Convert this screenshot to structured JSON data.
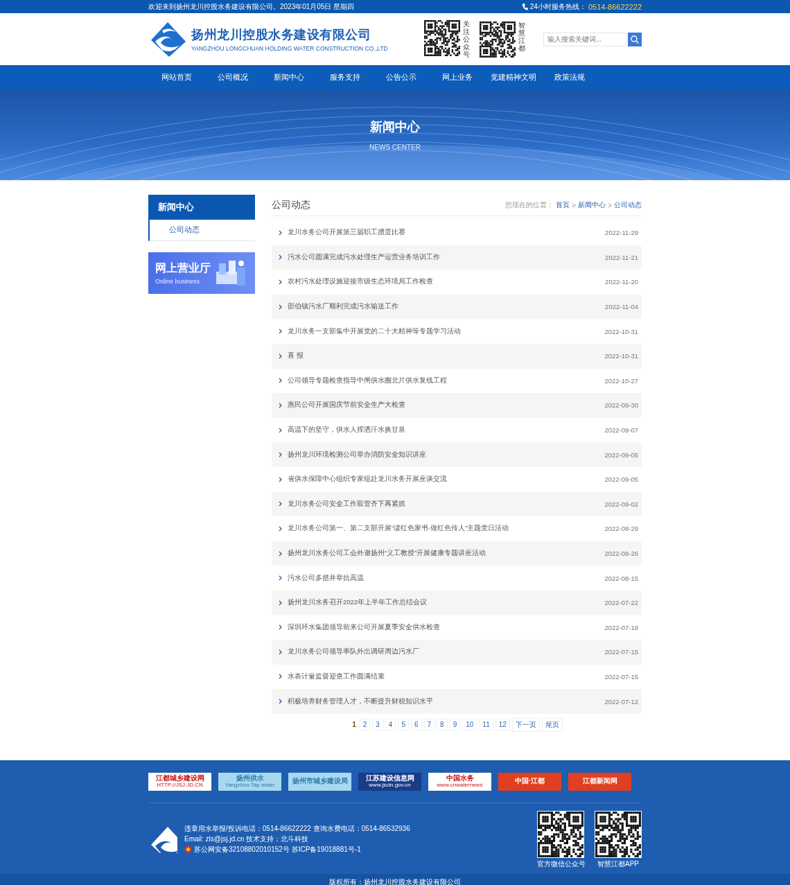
{
  "top_bar": {
    "welcome": "欢迎来到扬州龙川控股水务建设有限公司。2023年01月05日 星期四",
    "hotline_label": "24小时服务热线：",
    "hotline": "0514-86622222"
  },
  "header": {
    "company_name": "扬州龙川控股水务建设有限公司",
    "company_name_en": "YANGZHOU LONGCHUAN HOLDING WATER CONSTRUCTION CO.,LTD",
    "qr_codes": [
      {
        "caption": "关注公众号"
      },
      {
        "caption": "智慧江都"
      }
    ],
    "search": {
      "placeholder": "输入搜索关键词..."
    }
  },
  "nav": [
    {
      "label": "网站首页"
    },
    {
      "label": "公司概况"
    },
    {
      "label": "新闻中心"
    },
    {
      "label": "服务支持"
    },
    {
      "label": "公告公示"
    },
    {
      "label": "网上业务"
    },
    {
      "label": "党建精神文明"
    },
    {
      "label": "政策法规"
    }
  ],
  "banner": {
    "title": "新闻中心",
    "subtitle": "NEWS CENTER"
  },
  "sidebar": {
    "title": "新闻中心",
    "items": [
      {
        "label": "公司动态",
        "selected": true
      }
    ],
    "promo": {
      "title": "网上营业厅",
      "subtitle": "Online business"
    }
  },
  "content": {
    "title": "公司动态",
    "breadcrumb": {
      "label": "您现在的位置：",
      "separator": ">",
      "links": [
        "首页",
        "新闻中心",
        "公司动态"
      ]
    },
    "news": [
      {
        "title": "龙川水务公司开展第三届职工掼蛋比赛",
        "date": "2022-11-29"
      },
      {
        "title": "污水公司圆满完成污水处理生产运营业务培训工作",
        "date": "2022-11-21"
      },
      {
        "title": "农村污水处理设施迎接市级生态环境局工作检查",
        "date": "2022-11-20"
      },
      {
        "title": "邵伯镇污水厂顺利完成污水输送工作",
        "date": "2022-11-04"
      },
      {
        "title": "龙川水务一支部集中开展党的二十大精神等专题学习活动",
        "date": "2022-10-31"
      },
      {
        "title": "喜 报",
        "date": "2022-10-31"
      },
      {
        "title": "公司领导专题检查指导中闸供水圈北片供水复线工程",
        "date": "2022-10-27"
      },
      {
        "title": "惠民公司开展国庆节前安全生产大检查",
        "date": "2022-09-30"
      },
      {
        "title": "高温下的坚守，供水人挥洒汗水换甘泉",
        "date": "2022-09-07"
      },
      {
        "title": "扬州龙川环境检测公司举办消防安全知识讲座",
        "date": "2022-09-05"
      },
      {
        "title": "省供水保障中心组织专家组赴龙川水务开展座谈交流",
        "date": "2022-09-05"
      },
      {
        "title": "龙川水务公司安全工作双管齐下再紧抓",
        "date": "2022-09-02"
      },
      {
        "title": "龙川水务公司第一、第二支部开展“读红色家书·做红色传人”主题党日活动",
        "date": "2022-08-29"
      },
      {
        "title": "扬州龙川水务公司工会外邀扬州“义工教授”开展健康专题讲座活动",
        "date": "2022-08-26"
      },
      {
        "title": "污水公司多措并举抗高温",
        "date": "2022-08-15"
      },
      {
        "title": "扬州龙川水务召开2022年上半年工作总结会议",
        "date": "2022-07-22"
      },
      {
        "title": "深圳环水集团领导前来公司开展夏季安全供水检查",
        "date": "2022-07-18"
      },
      {
        "title": "龙川水务公司领导率队外出调研周边污水厂",
        "date": "2022-07-15"
      },
      {
        "title": "水表计量监督迎查工作圆满结束",
        "date": "2022-07-15"
      },
      {
        "title": "积极培养财务管理人才，不断提升财税知识水平",
        "date": "2022-07-12"
      }
    ],
    "pagination": [
      {
        "label": "1",
        "selected": true
      },
      {
        "label": "2",
        "selected": false
      },
      {
        "label": "3",
        "selected": false
      },
      {
        "label": "4",
        "selected": false
      },
      {
        "label": "5",
        "selected": false
      },
      {
        "label": "6",
        "selected": false
      },
      {
        "label": "7",
        "selected": false
      },
      {
        "label": "8",
        "selected": false
      },
      {
        "label": "9",
        "selected": false
      },
      {
        "label": "10",
        "selected": false
      },
      {
        "label": "11",
        "selected": false
      },
      {
        "label": "12",
        "selected": false
      },
      {
        "label": "下一页",
        "selected": false
      },
      {
        "label": "尾页",
        "selected": false
      }
    ]
  },
  "footer": {
    "links": [
      {
        "label": "江都城乡建设网",
        "sublabel": "HTTP://JSJ.JD.CN",
        "kind": "white"
      },
      {
        "label": "扬州供水",
        "sublabel": "Yangzhou Tap water",
        "kind": "light"
      },
      {
        "label": "扬州市城乡建设局",
        "kind": "light"
      },
      {
        "label": "江苏建设信息网",
        "sublabel": "www.jscin.gov.cn",
        "kind": "navy"
      },
      {
        "label": "中国水务",
        "sublabel": "www.cnwaternews",
        "kind": "white"
      },
      {
        "label": "中国·江都",
        "kind": "red"
      },
      {
        "label": "江都新闻网",
        "kind": "red"
      }
    ],
    "contact": [
      "违章用水举报/投诉电话：0514-86622222 查询水费电话：0514-86532936",
      "Email: zls@jsj.jd.cn 技术支持：北斗科技",
      "苏公网安备32108802010152号 苏ICP备19018881号-1"
    ],
    "qr_codes": [
      {
        "caption": "官方微信公众号"
      },
      {
        "caption": "智慧江都APP"
      }
    ],
    "copyright": "版权所有：扬州龙川控股水务建设有限公司"
  }
}
